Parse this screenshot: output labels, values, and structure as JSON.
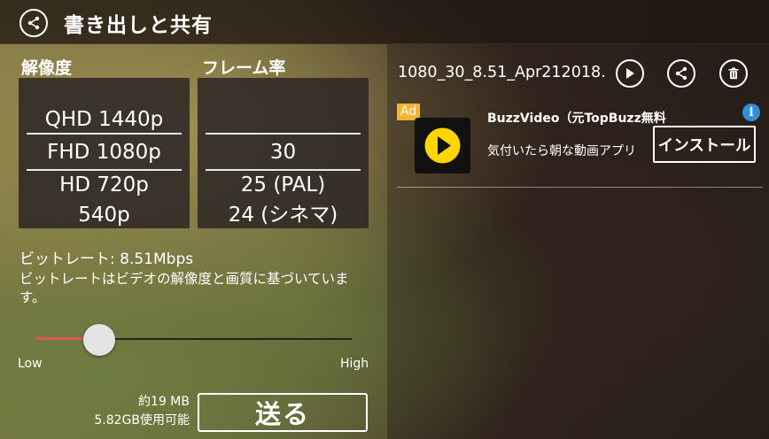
{
  "header": {
    "title": "書き出しと共有"
  },
  "left": {
    "resolution_label": "解像度",
    "framerate_label": "フレーム率",
    "resolutions": [
      "QHD 1440p",
      "FHD 1080p",
      "HD 720p",
      "540p"
    ],
    "framerates": [
      "30",
      "25 (PAL)",
      "24 (シネマ)"
    ],
    "bitrate": "ビットレート: 8.51Mbps",
    "bitrate_desc": "ビットレートはビデオの解像度と画質に基づいています。",
    "slider": {
      "low": "Low",
      "high": "High",
      "value_fraction": 0.2
    },
    "size": "約19 MB",
    "available": "5.82GB使用可能",
    "send_label": "送る"
  },
  "right": {
    "file_name": "1080_30_8.51_Apr212018…",
    "ad": {
      "badge": "Ad",
      "title": "BuzzVideo（元TopBuzz無料",
      "description": "気付いたら朝な動画アプリ",
      "install_label": "インストール",
      "info_glyph": "i"
    }
  },
  "colors": {
    "slider_fill": "#e0564b",
    "ad_badge": "#f3b531",
    "ad_info": "#2f8fd8",
    "logo_yellow": "#ffd600"
  }
}
